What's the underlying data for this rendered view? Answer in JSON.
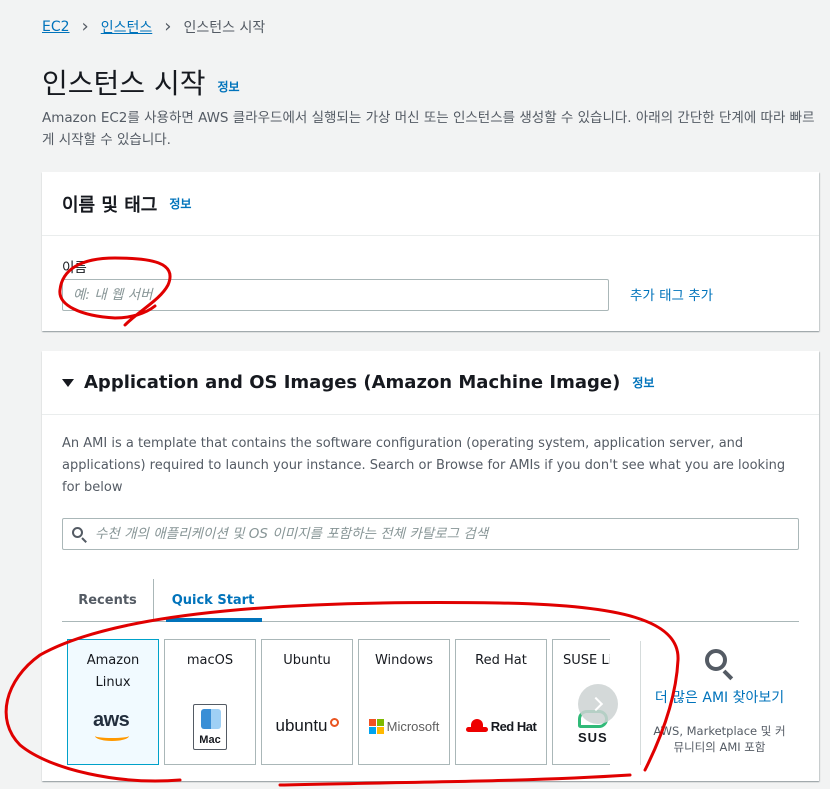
{
  "breadcrumb": {
    "items": [
      "EC2",
      "인스턴스",
      "인스턴스 시작"
    ]
  },
  "page": {
    "title": "인스턴스 시작",
    "info": "정보",
    "description": "Amazon EC2를 사용하면 AWS 클라우드에서 실행되는 가상 머신 또는 인스턴스를 생성할 수 있습니다. 아래의 간단한 단계에 따라 빠르게 시작할 수 있습니다."
  },
  "name_section": {
    "title": "이름 및 태그",
    "info": "정보",
    "field_label": "이름",
    "placeholder": "예: 내 웹 서버",
    "add_tag_link": "추가 태그 추가"
  },
  "ami_section": {
    "title": "Application and OS Images (Amazon Machine Image)",
    "info": "정보",
    "description": "An AMI is a template that contains the software configuration (operating system, application server, and applications) required to launch your instance. Search or Browse for AMIs if you don't see what you are looking for below",
    "search_placeholder": "수천 개의 애플리케이션 및 OS 이미지를 포함하는 전체 카탈로그 검색",
    "tabs": [
      "Recents",
      "Quick Start"
    ],
    "active_tab": "Quick Start",
    "tiles": [
      {
        "label": "Amazon Linux",
        "logo_text": "aws",
        "selected": true
      },
      {
        "label": "macOS",
        "logo_text": "Mac",
        "selected": false
      },
      {
        "label": "Ubuntu",
        "logo_text": "ubuntu",
        "selected": false
      },
      {
        "label": "Windows",
        "logo_text": "Microsoft",
        "selected": false
      },
      {
        "label": "Red Hat",
        "logo_text": "Red Hat",
        "selected": false
      },
      {
        "label": "SUSE Li",
        "logo_text": "SUS",
        "selected": false
      }
    ],
    "browse_more_link": "더 많은 AMI 찾아보기",
    "browse_more_note": "AWS, Marketplace 및 커뮤니티의 AMI 포함"
  },
  "colors": {
    "link": "#0073bb",
    "annotation": "#e00000",
    "background": "#f2f3f3"
  }
}
